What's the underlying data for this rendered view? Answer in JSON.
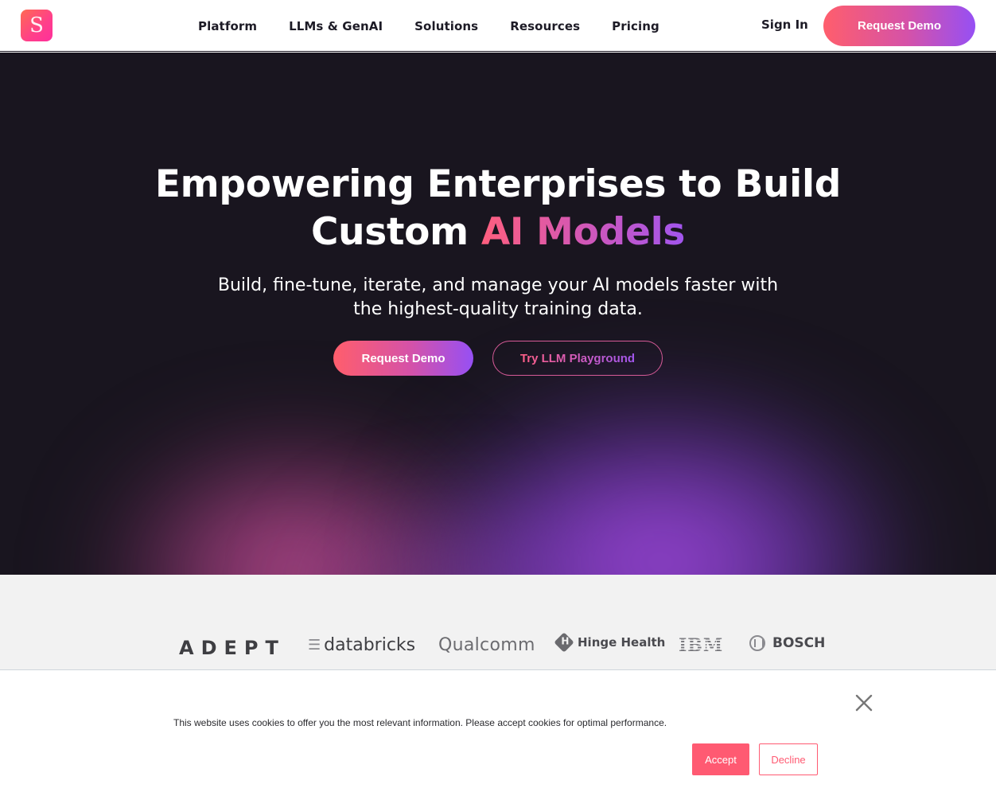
{
  "brand": {
    "logo_letter": "S",
    "accent_gradient": [
      "#ff5e6c",
      "#d552a8",
      "#9650f4"
    ]
  },
  "nav": {
    "links": [
      "Platform",
      "LLMs & GenAI",
      "Solutions",
      "Resources",
      "Pricing"
    ],
    "sign_in": "Sign In",
    "cta": "Request Demo"
  },
  "hero": {
    "title_line1": "Empowering Enterprises to Build",
    "title_line2_plain": "Custom ",
    "title_line2_accent": "AI Models",
    "subtitle_line1": "Build, fine-tune, iterate, and manage your AI models faster with",
    "subtitle_line2": "the highest-quality training data.",
    "primary_button": "Request Demo",
    "secondary_button": "Try LLM Playground"
  },
  "customers": {
    "logos": [
      "ADEPT",
      "databricks",
      "Qualcomm",
      "Hinge Health",
      "IBM",
      "BOSCH"
    ]
  },
  "cookie_banner": {
    "message": "This website uses cookies to offer you the most relevant information. Please accept cookies for optimal performance.",
    "accept": "Accept",
    "decline": "Decline",
    "close_icon": "close-icon"
  }
}
